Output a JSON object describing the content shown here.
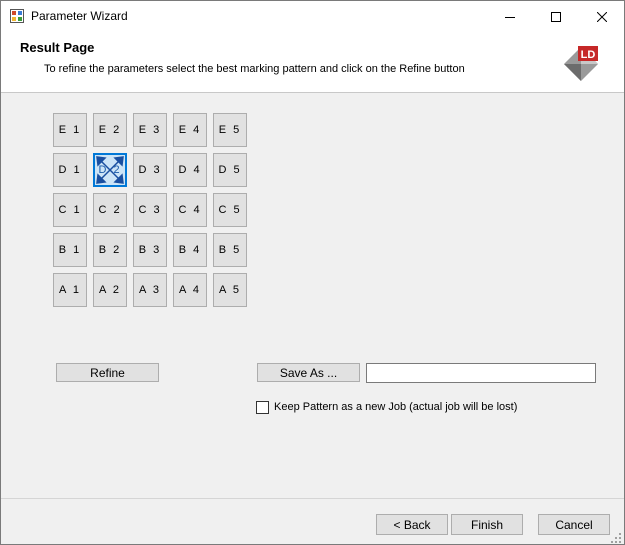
{
  "window": {
    "title": "Parameter Wizard"
  },
  "header": {
    "title": "Result Page",
    "subtitle": "To refine the parameters select the best marking pattern and click on the Refine button",
    "logo_text": "LD"
  },
  "grid": {
    "rows": [
      [
        "E 1",
        "E 2",
        "E 3",
        "E 4",
        "E 5"
      ],
      [
        "D 1",
        "D 2",
        "D 3",
        "D 4",
        "D 5"
      ],
      [
        "C 1",
        "C 2",
        "C 3",
        "C 4",
        "C 5"
      ],
      [
        "B 1",
        "B 2",
        "B 3",
        "B 4",
        "B 5"
      ],
      [
        "A 1",
        "A 2",
        "A 3",
        "A 4",
        "A 5"
      ]
    ],
    "selected": "D 2"
  },
  "actions": {
    "refine_label": "Refine",
    "save_as_label": "Save As ...",
    "save_as_value": "",
    "keep_pattern_label": "Keep Pattern as a new Job (actual job will be lost)",
    "keep_pattern_checked": false
  },
  "footer": {
    "back_label": "< Back",
    "finish_label": "Finish",
    "cancel_label": "Cancel"
  },
  "colors": {
    "accent": "#0078d7",
    "window_bg": "#f0f0f0",
    "button_bg": "#e1e1e1"
  }
}
